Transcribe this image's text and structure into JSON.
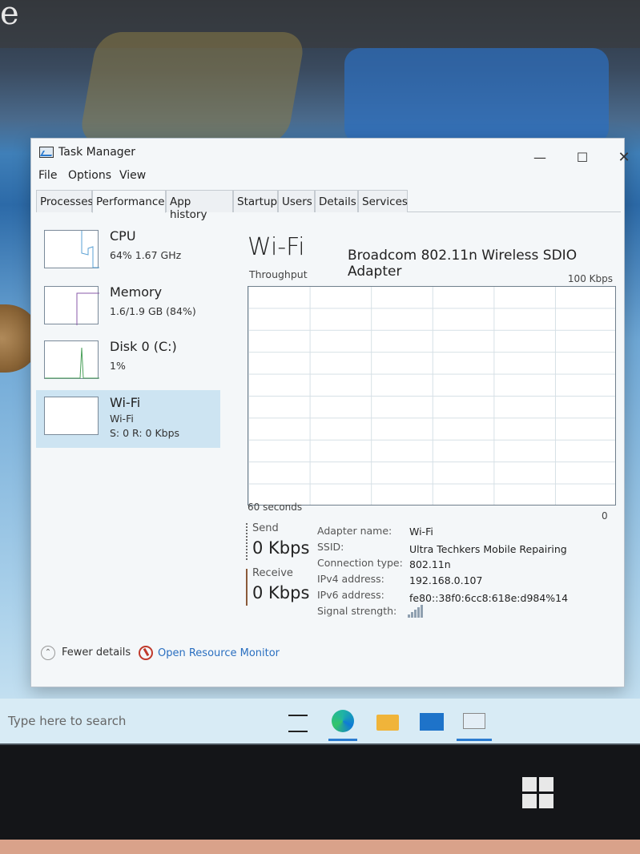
{
  "window": {
    "title": "Task Manager",
    "min_glyph": "—",
    "max_glyph": "☐",
    "close_glyph": "✕"
  },
  "menu": [
    "File",
    "Options",
    "View"
  ],
  "tabs": [
    "Processes",
    "Performance",
    "App history",
    "Startup",
    "Users",
    "Details",
    "Services"
  ],
  "active_tab": "Performance",
  "sidebar": [
    {
      "title": "CPU",
      "line1": "64% 1.67 GHz",
      "line2": ""
    },
    {
      "title": "Memory",
      "line1": "1.6/1.9 GB (84%)",
      "line2": ""
    },
    {
      "title": "Disk 0 (C:)",
      "line1": "1%",
      "line2": ""
    },
    {
      "title": "Wi-Fi",
      "line1": "Wi-Fi",
      "line2": "S: 0 R: 0 Kbps"
    }
  ],
  "main": {
    "title": "Wi-Fi",
    "adapter": "Broadcom 802.11n Wireless SDIO Adapter",
    "throughput_label": "Throughput",
    "max_label": "100 Kbps",
    "time_label": "60 seconds",
    "zero_label": "0"
  },
  "stats": {
    "send_label": "Send",
    "send_value": "0 Kbps",
    "receive_label": "Receive",
    "receive_value": "0 Kbps"
  },
  "properties": [
    {
      "label": "Adapter name:",
      "value": "Wi-Fi"
    },
    {
      "label": "SSID:",
      "value": "Ultra Techkers Mobile Repairing"
    },
    {
      "label": "Connection type:",
      "value": "802.11n"
    },
    {
      "label": "IPv4 address:",
      "value": "192.168.0.107"
    },
    {
      "label": "IPv6 address:",
      "value": "fe80::38f0:6cc8:618e:d984%14"
    },
    {
      "label": "Signal strength:",
      "value": ""
    }
  ],
  "footer": {
    "fewer_details": "Fewer details",
    "open_resource_monitor": "Open Resource Monitor"
  },
  "taskbar": {
    "search_placeholder": "Type here to search"
  },
  "background": {
    "edge_letter": "e"
  },
  "colors": {
    "selected_bg": "#cde4f2",
    "link": "#2a6fc0",
    "accent": "#2b7bd0"
  }
}
